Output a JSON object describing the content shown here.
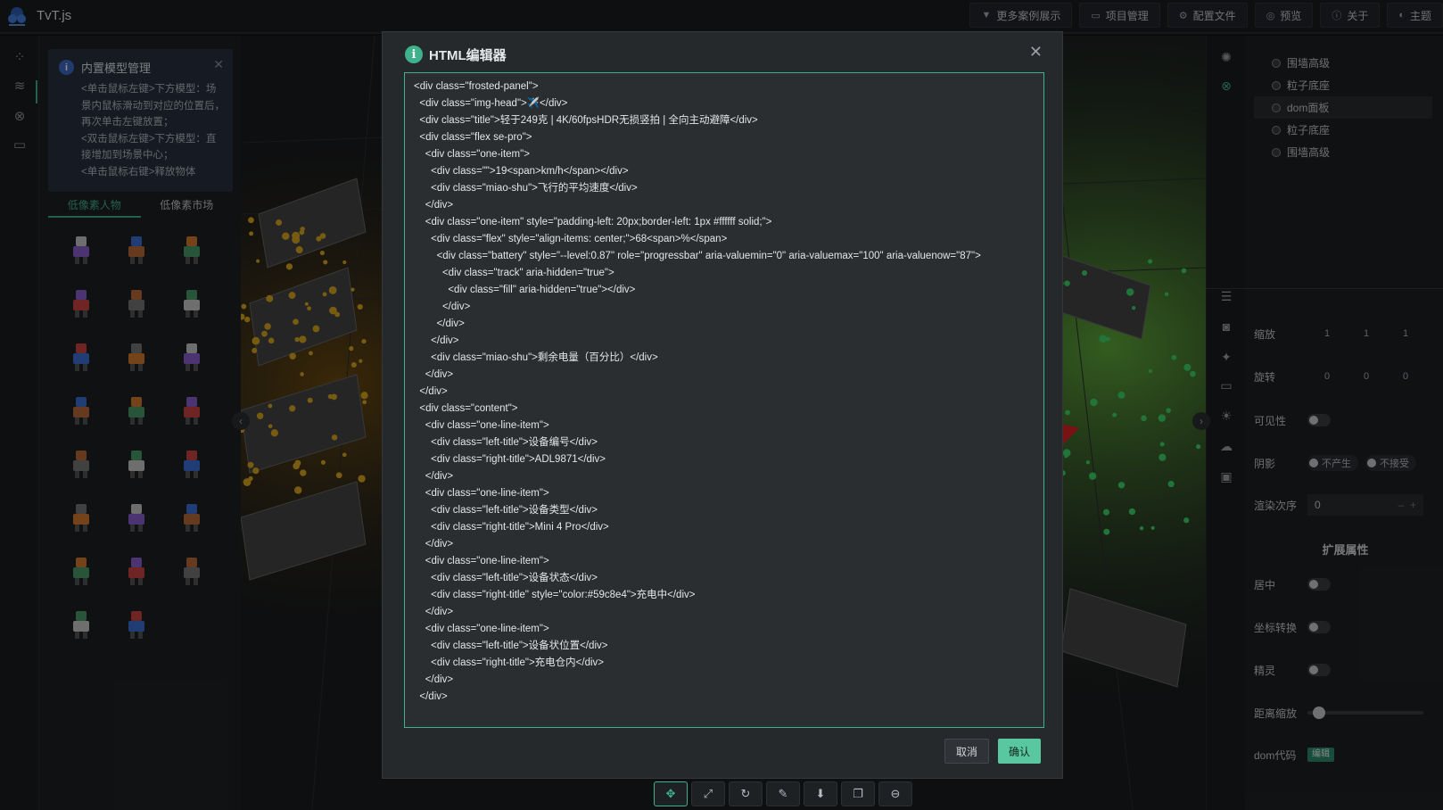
{
  "app": {
    "title": "TvT.js"
  },
  "topnav": [
    {
      "icon": "filter-icon",
      "label": "更多案例展示"
    },
    {
      "icon": "folder-icon",
      "label": "项目管理"
    },
    {
      "icon": "gear-icon",
      "label": "配置文件"
    },
    {
      "icon": "preview-icon",
      "label": "预览"
    },
    {
      "icon": "info-icon",
      "label": "关于"
    },
    {
      "icon": "theme-icon",
      "label": "主题"
    }
  ],
  "left_panel": {
    "notice": {
      "title": "内置模型管理",
      "body": "<单击鼠标左键>下方模型：场景内鼠标滑动到对应的位置后，再次单击左键放置；\n<双击鼠标左键>下方模型：直接增加到场景中心；\n<单击鼠标右键>释放物体"
    },
    "tabs": [
      "低像素人物",
      "低像素市场"
    ],
    "models_count": 23
  },
  "right_panel": {
    "tree": [
      "围墙高级",
      "粒子底座",
      "dom面板",
      "粒子底座",
      "围墙高级"
    ],
    "selected_index": 2,
    "props": {
      "scale_label": "缩放",
      "scale": [
        "1",
        "1",
        "1"
      ],
      "rotate_label": "旋转",
      "rotate": [
        "0",
        "0",
        "0"
      ],
      "visible_label": "可见性",
      "shadow_label": "阴影",
      "shadow_cast": "不产生",
      "shadow_receive": "不接受",
      "render_order_label": "渲染次序",
      "render_order": "0",
      "ext_title": "扩展属性",
      "center_label": "居中",
      "coord_label": "坐标转换",
      "sprite_label": "精灵",
      "distance_scale_label": "距离缩放",
      "dom_code_label": "dom代码",
      "edit_label": "编辑"
    }
  },
  "modal": {
    "title": "HTML编辑器",
    "code": [
      "<div class=\"frosted-panel\">",
      "  <div class=\"img-head\">✈️</div>",
      "  <div class=\"title\">轻于249克 | 4K/60fpsHDR无损竖拍 | 全向主动避障</div>",
      "  <div class=\"flex se-pro\">",
      "    <div class=\"one-item\">",
      "      <div class=\"\">19<span>km/h</span></div>",
      "      <div class=\"miao-shu\">飞行的平均速度</div>",
      "    </div>",
      "    <div class=\"one-item\" style=\"padding-left: 20px;border-left: 1px #ffffff solid;\">",
      "      <div class=\"flex\" style=\"align-items: center;\">68<span>%</span>",
      "        <div class=\"battery\" style=\"--level:0.87\" role=\"progressbar\" aria-valuemin=\"0\" aria-valuemax=\"100\" aria-valuenow=\"87\">",
      "          <div class=\"track\" aria-hidden=\"true\">",
      "            <div class=\"fill\" aria-hidden=\"true\"></div>",
      "          </div>",
      "        </div>",
      "      </div>",
      "      <div class=\"miao-shu\">剩余电量（百分比）</div>",
      "    </div>",
      "  </div>",
      "  <div class=\"content\">",
      "    <div class=\"one-line-item\">",
      "      <div class=\"left-title\">设备编号</div>",
      "      <div class=\"right-title\">ADL9871</div>",
      "    </div>",
      "    <div class=\"one-line-item\">",
      "      <div class=\"left-title\">设备类型</div>",
      "      <div class=\"right-title\">Mini 4 Pro</div>",
      "    </div>",
      "    <div class=\"one-line-item\">",
      "      <div class=\"left-title\">设备状态</div>",
      "      <div class=\"right-title\" style=\"color:#59c8e4\">充电中</div>",
      "    </div>",
      "    <div class=\"one-line-item\">",
      "      <div class=\"left-title\">设备状位置</div>",
      "      <div class=\"right-title\">充电仓内</div>",
      "    </div>",
      "  </div>"
    ],
    "cancel": "取消",
    "confirm": "确认"
  },
  "bottom_tools": [
    "move-icon",
    "scale-icon",
    "rotate-icon",
    "brush-icon",
    "import-icon",
    "copy-icon",
    "delete-icon"
  ],
  "colors": {
    "accent": "#3fb28c",
    "confirm": "#59c8a0"
  }
}
